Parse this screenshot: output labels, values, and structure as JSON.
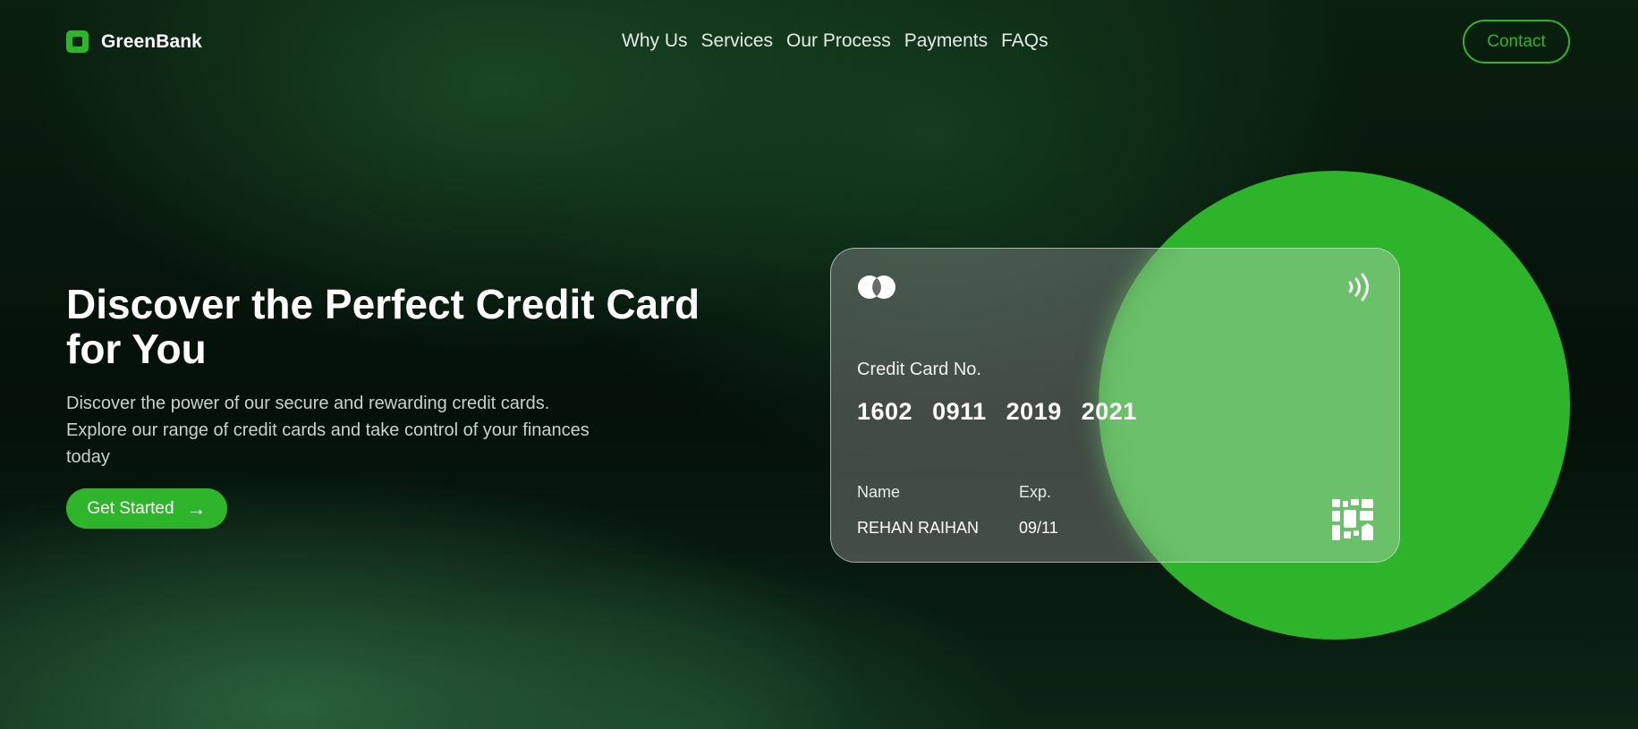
{
  "brand": {
    "name": "GreenBank",
    "accent_color": "#2fb52c",
    "logo_icon": "logo-mark-icon"
  },
  "nav": {
    "items": [
      "Why Us",
      "Services",
      "Our Process",
      "Payments",
      "FAQs"
    ]
  },
  "header": {
    "contact_label": "Contact"
  },
  "hero": {
    "title": "Discover the Perfect Credit Card for You",
    "description": "Discover the power of our secure and rewarding credit cards. Explore our range of credit cards and take control of your finances today",
    "cta_label": "Get Started",
    "cta_icon": "arrow-right-icon"
  },
  "card": {
    "network_icon": "mastercard-icon",
    "contactless_icon": "contactless-icon",
    "chip_icon": "qr-code-icon",
    "number_label": "Credit Card No.",
    "number_groups": [
      "1602",
      "0911",
      "2019",
      "2021"
    ],
    "name_label": "Name",
    "name_value": "REHAN RAIHAN",
    "exp_label": "Exp.",
    "exp_value": "09/11"
  }
}
